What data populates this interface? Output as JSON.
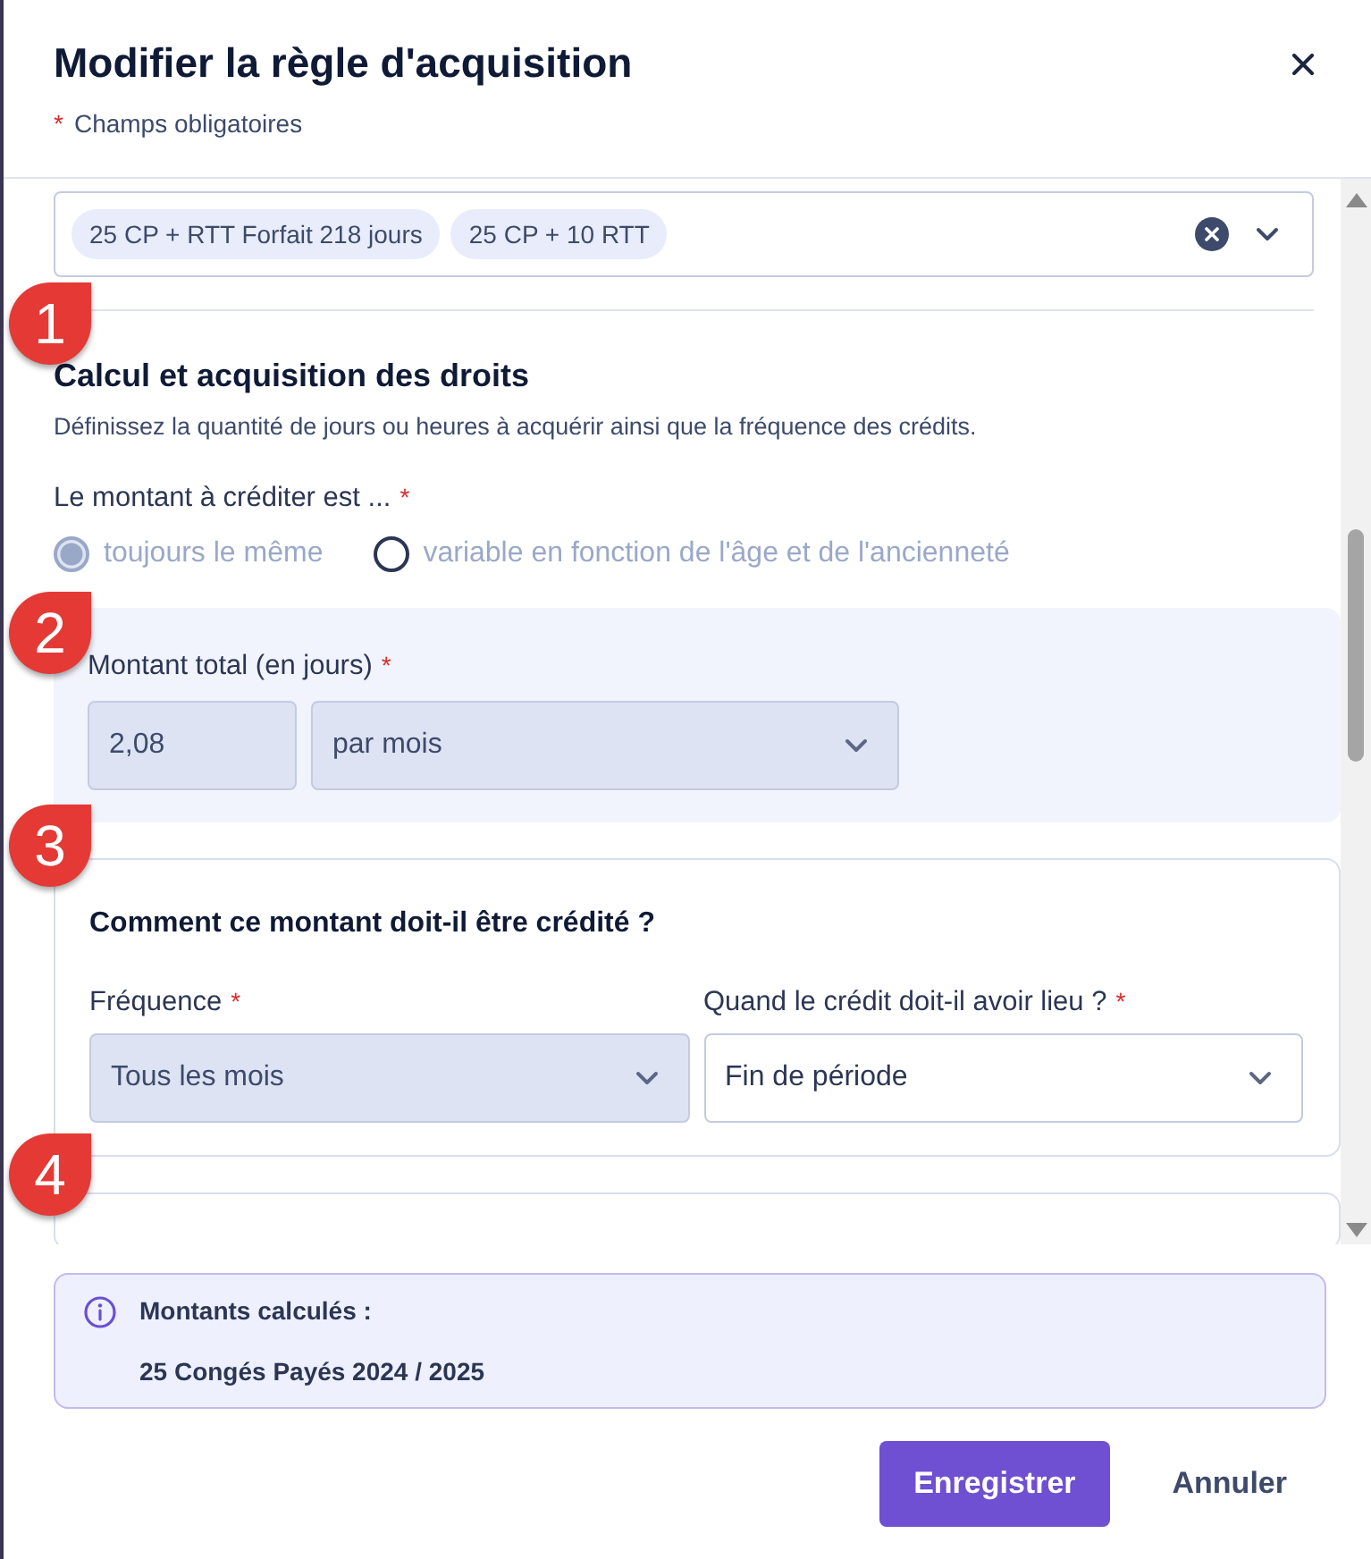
{
  "dialog": {
    "title": "Modifier la règle d'acquisition",
    "required_note": {
      "mark": "*",
      "text": "Champs obligatoires"
    }
  },
  "tags_field": {
    "tags": [
      "25 CP + RTT Forfait 218 jours",
      "25 CP + 10 RTT"
    ],
    "marker": "1"
  },
  "section": {
    "title": "Calcul et acquisition des droits",
    "description": "Définissez la quantité de jours ou heures à acquérir ainsi que la fréquence des crédits."
  },
  "amount_type": {
    "label": "Le montant à créditer est ...",
    "required_mark": "*",
    "disabled": true,
    "options": [
      {
        "label": "toujours le même",
        "selected": true
      },
      {
        "label": "variable en fonction de l'âge et de l'ancienneté",
        "selected": false
      }
    ]
  },
  "amount": {
    "label": "Montant total (en jours)",
    "required_mark": "*",
    "value": "2,08",
    "period": "par mois",
    "disabled": true,
    "marker": "2"
  },
  "credit": {
    "title": "Comment ce montant doit-il être crédité ?",
    "markers": [
      "3",
      "4"
    ],
    "fields": [
      {
        "label": "Fréquence",
        "required_mark": "*",
        "value": "Tous les mois",
        "disabled": true
      },
      {
        "label": "Quand le crédit doit-il avoir lieu ?",
        "required_mark": "*",
        "value": "Fin de période",
        "disabled": false
      }
    ]
  },
  "info": {
    "title": "Montants calculés :",
    "text": "25 Congés Payés 2024 / 2025"
  },
  "buttons": [
    {
      "label": "Enregistrer",
      "kind": "primary"
    },
    {
      "label": "Annuler",
      "kind": "secondary"
    }
  ]
}
